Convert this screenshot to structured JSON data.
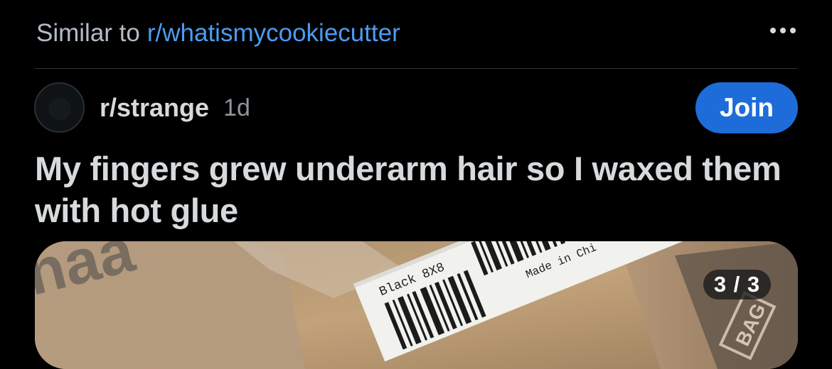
{
  "recommendation": {
    "prefix": "Similar to",
    "community_link": "r/whatismycookiecutter"
  },
  "post": {
    "subreddit": "r/strange",
    "age": "1d",
    "join_label": "Join",
    "title": "My fingers grew underarm hair so I waxed them with hot glue",
    "image_counter": "3 / 3"
  },
  "image_text": {
    "barcode_label": "Black 8X8",
    "made_in": "Made in Chi",
    "box_print": "BAG"
  },
  "colors": {
    "background": "#000000",
    "link": "#4b9cf2",
    "join_button": "#1d6cd9"
  },
  "icons": {
    "more": "more-horizontal-icon"
  }
}
